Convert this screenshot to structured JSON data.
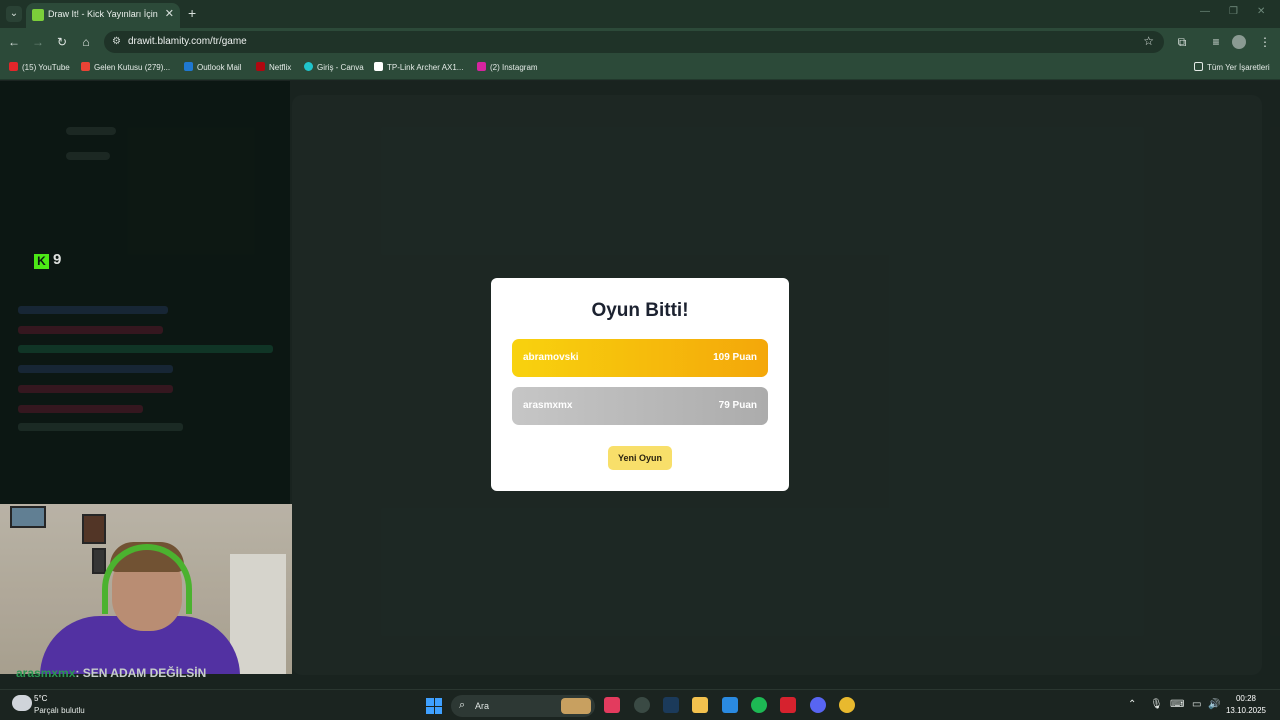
{
  "browser": {
    "tab_title": "Draw It! - Kick Yayınları İçin Çizi",
    "url": "drawit.blamity.com/tr/game",
    "bookmarks": [
      {
        "label": "(15) YouTube",
        "color": "#e3262a"
      },
      {
        "label": "Gelen Kutusu (279)...",
        "color": "#ea4335"
      },
      {
        "label": "Outlook Mail",
        "color": "#1f78d1"
      },
      {
        "label": "Netflix",
        "color": "#b00710"
      },
      {
        "label": "Giriş - Canva",
        "color": "#20c4cb"
      },
      {
        "label": "TP-Link Archer AX1...",
        "color": "#ffffff"
      },
      {
        "label": "(2) Instagram",
        "color": "#d6249f"
      }
    ],
    "all_bookmarks": "Tüm Yer İşaretleri"
  },
  "game": {
    "kick_count": "9",
    "modal_title": "Oyun Bitti!",
    "scores": [
      {
        "name": "abramovski",
        "points": "109 Puan"
      },
      {
        "name": "arasmxmx",
        "points": "79 Puan"
      }
    ],
    "new_game_label": "Yeni Oyun"
  },
  "chat": {
    "user": "arasmxmx",
    "message": ": SEN ADAM DEĞİLSİN"
  },
  "taskbar": {
    "temperature": "5°C",
    "weather": "Parçalı bulutlu",
    "search_label": "Ara",
    "time": "00:28",
    "date": "13.10.2025"
  }
}
